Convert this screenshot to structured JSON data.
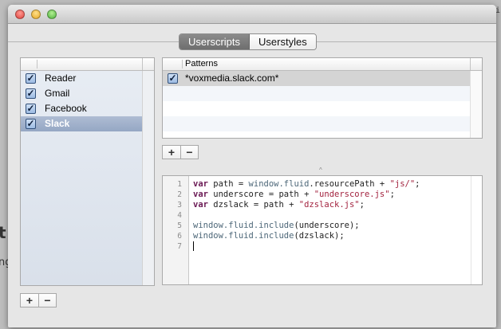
{
  "background_fragments": [
    "t",
    "ng",
    "i"
  ],
  "window": {
    "traffic_lights": {
      "close": "#e0443e",
      "minimize": "#e7a823",
      "zoom": "#4fb33d"
    }
  },
  "tabs": [
    {
      "label": "Userscripts",
      "active": true
    },
    {
      "label": "Userstyles",
      "active": false
    }
  ],
  "scripts": {
    "items": [
      {
        "label": "Reader",
        "checked": true
      },
      {
        "label": "Gmail",
        "checked": true
      },
      {
        "label": "Facebook",
        "checked": true
      },
      {
        "label": "Slack",
        "checked": true,
        "selected": true
      }
    ],
    "add_label": "+",
    "remove_label": "−"
  },
  "patterns": {
    "header": "Patterns",
    "items": [
      {
        "label": "*voxmedia.slack.com*",
        "checked": true
      }
    ],
    "add_label": "+",
    "remove_label": "−"
  },
  "editor": {
    "line_numbers": [
      "1",
      "2",
      "3",
      "4",
      "5",
      "6",
      "7"
    ],
    "lines": [
      [
        {
          "t": "var",
          "c": "kw"
        },
        {
          "t": " path = ",
          "c": ""
        },
        {
          "t": "window.fluid",
          "c": "obj"
        },
        {
          "t": ".resourcePath + ",
          "c": ""
        },
        {
          "t": "\"js/\"",
          "c": "str"
        },
        {
          "t": ";",
          "c": ""
        }
      ],
      [
        {
          "t": "var",
          "c": "kw"
        },
        {
          "t": " underscore = path + ",
          "c": ""
        },
        {
          "t": "\"underscore.js\"",
          "c": "str"
        },
        {
          "t": ";",
          "c": ""
        }
      ],
      [
        {
          "t": "var",
          "c": "kw"
        },
        {
          "t": " dzslack = path + ",
          "c": ""
        },
        {
          "t": "\"dzslack.js\"",
          "c": "str"
        },
        {
          "t": ";",
          "c": ""
        }
      ],
      [],
      [
        {
          "t": "window.fluid.include",
          "c": "obj"
        },
        {
          "t": "(underscore);",
          "c": ""
        }
      ],
      [
        {
          "t": "window.fluid.include",
          "c": "obj"
        },
        {
          "t": "(dzslack);",
          "c": ""
        }
      ],
      []
    ]
  }
}
